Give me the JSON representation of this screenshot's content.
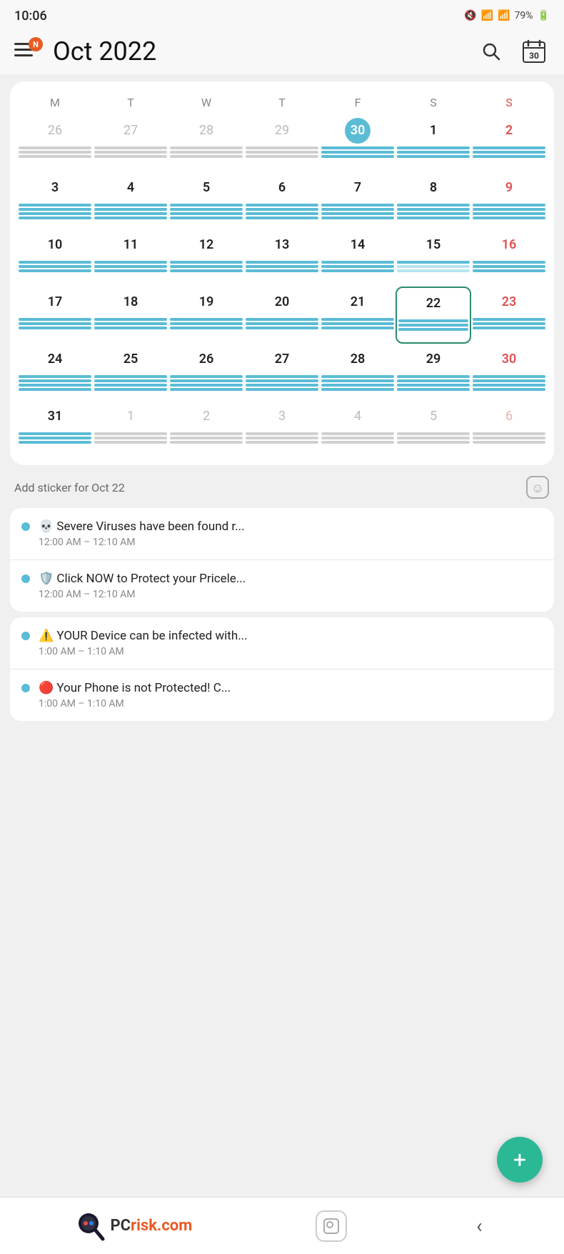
{
  "status": {
    "time": "10:06",
    "battery": "79%",
    "icons": "🔇 📶 79%"
  },
  "header": {
    "notification_label": "N",
    "title": "Oct  2022",
    "search_label": "search",
    "calendar_label": "30"
  },
  "calendar": {
    "day_headers": [
      "M",
      "T",
      "W",
      "T",
      "F",
      "S",
      "S"
    ],
    "weeks": [
      [
        {
          "date": "26",
          "type": "prev"
        },
        {
          "date": "27",
          "type": "prev"
        },
        {
          "date": "28",
          "type": "prev"
        },
        {
          "date": "29",
          "type": "prev"
        },
        {
          "date": "30",
          "type": "today"
        },
        {
          "date": "1",
          "type": "normal"
        },
        {
          "date": "2",
          "type": "sunday"
        }
      ],
      [
        {
          "date": "3",
          "type": "normal"
        },
        {
          "date": "4",
          "type": "normal"
        },
        {
          "date": "5",
          "type": "normal"
        },
        {
          "date": "6",
          "type": "normal"
        },
        {
          "date": "7",
          "type": "normal"
        },
        {
          "date": "8",
          "type": "normal"
        },
        {
          "date": "9",
          "type": "sunday"
        }
      ],
      [
        {
          "date": "10",
          "type": "normal"
        },
        {
          "date": "11",
          "type": "normal"
        },
        {
          "date": "12",
          "type": "normal"
        },
        {
          "date": "13",
          "type": "normal"
        },
        {
          "date": "14",
          "type": "normal"
        },
        {
          "date": "15",
          "type": "normal"
        },
        {
          "date": "16",
          "type": "sunday"
        }
      ],
      [
        {
          "date": "17",
          "type": "normal"
        },
        {
          "date": "18",
          "type": "normal"
        },
        {
          "date": "19",
          "type": "normal"
        },
        {
          "date": "20",
          "type": "normal"
        },
        {
          "date": "21",
          "type": "normal"
        },
        {
          "date": "22",
          "type": "selected"
        },
        {
          "date": "23",
          "type": "sunday"
        }
      ],
      [
        {
          "date": "24",
          "type": "normal"
        },
        {
          "date": "25",
          "type": "normal"
        },
        {
          "date": "26",
          "type": "normal"
        },
        {
          "date": "27",
          "type": "normal"
        },
        {
          "date": "28",
          "type": "normal"
        },
        {
          "date": "29",
          "type": "normal"
        },
        {
          "date": "30",
          "type": "sunday"
        }
      ],
      [
        {
          "date": "31",
          "type": "normal"
        },
        {
          "date": "1",
          "type": "next"
        },
        {
          "date": "2",
          "type": "next"
        },
        {
          "date": "3",
          "type": "next"
        },
        {
          "date": "4",
          "type": "next"
        },
        {
          "date": "5",
          "type": "next"
        },
        {
          "date": "6",
          "type": "next-sunday"
        }
      ]
    ]
  },
  "add_sticker": {
    "text": "Add sticker for Oct 22"
  },
  "event_groups": [
    {
      "events": [
        {
          "dot_color": "#5bbcd6",
          "title": "💀 Severe Viruses have been found r...",
          "time": "12:00 AM – 12:10 AM"
        },
        {
          "dot_color": "#5bbcd6",
          "title": "🛡️ Click NOW to Protect your Pricele...",
          "time": "12:00 AM – 12:10 AM"
        }
      ]
    },
    {
      "events": [
        {
          "dot_color": "#5bbcd6",
          "title": "⚠️ YOUR Device can be infected with...",
          "time": "1:00 AM – 1:10 AM"
        },
        {
          "dot_color": "#5bbcd6",
          "title": "🔴 Your Phone is not Protected! C...",
          "time": "1:00 AM – 1:10 AM"
        }
      ]
    }
  ],
  "fab": {
    "label": "+"
  },
  "bottom": {
    "pcrisk": "PC",
    "pcrisk_accent": "risk.com",
    "back_label": "‹"
  }
}
